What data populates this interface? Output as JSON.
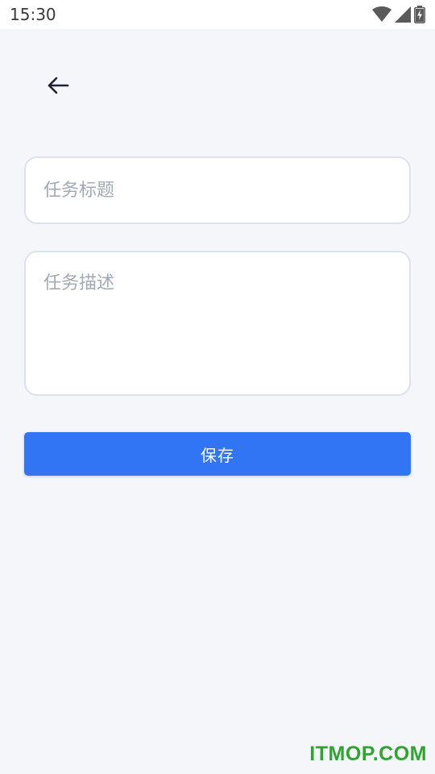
{
  "status_bar": {
    "time": "15:30",
    "icons": [
      "wifi-icon",
      "signal-icon",
      "battery-charging-icon"
    ]
  },
  "nav": {
    "back_icon": "arrow-left-icon"
  },
  "form": {
    "title_placeholder": "任务标题",
    "title_value": "",
    "description_placeholder": "任务描述",
    "description_value": "",
    "save_label": "保存"
  },
  "watermark": "ITMOP.COM",
  "colors": {
    "background": "#f5f6fa",
    "accent": "#3175f4",
    "placeholder": "#a3a9b6",
    "field_border": "#dde2ec",
    "watermark": "#2fa52f"
  }
}
